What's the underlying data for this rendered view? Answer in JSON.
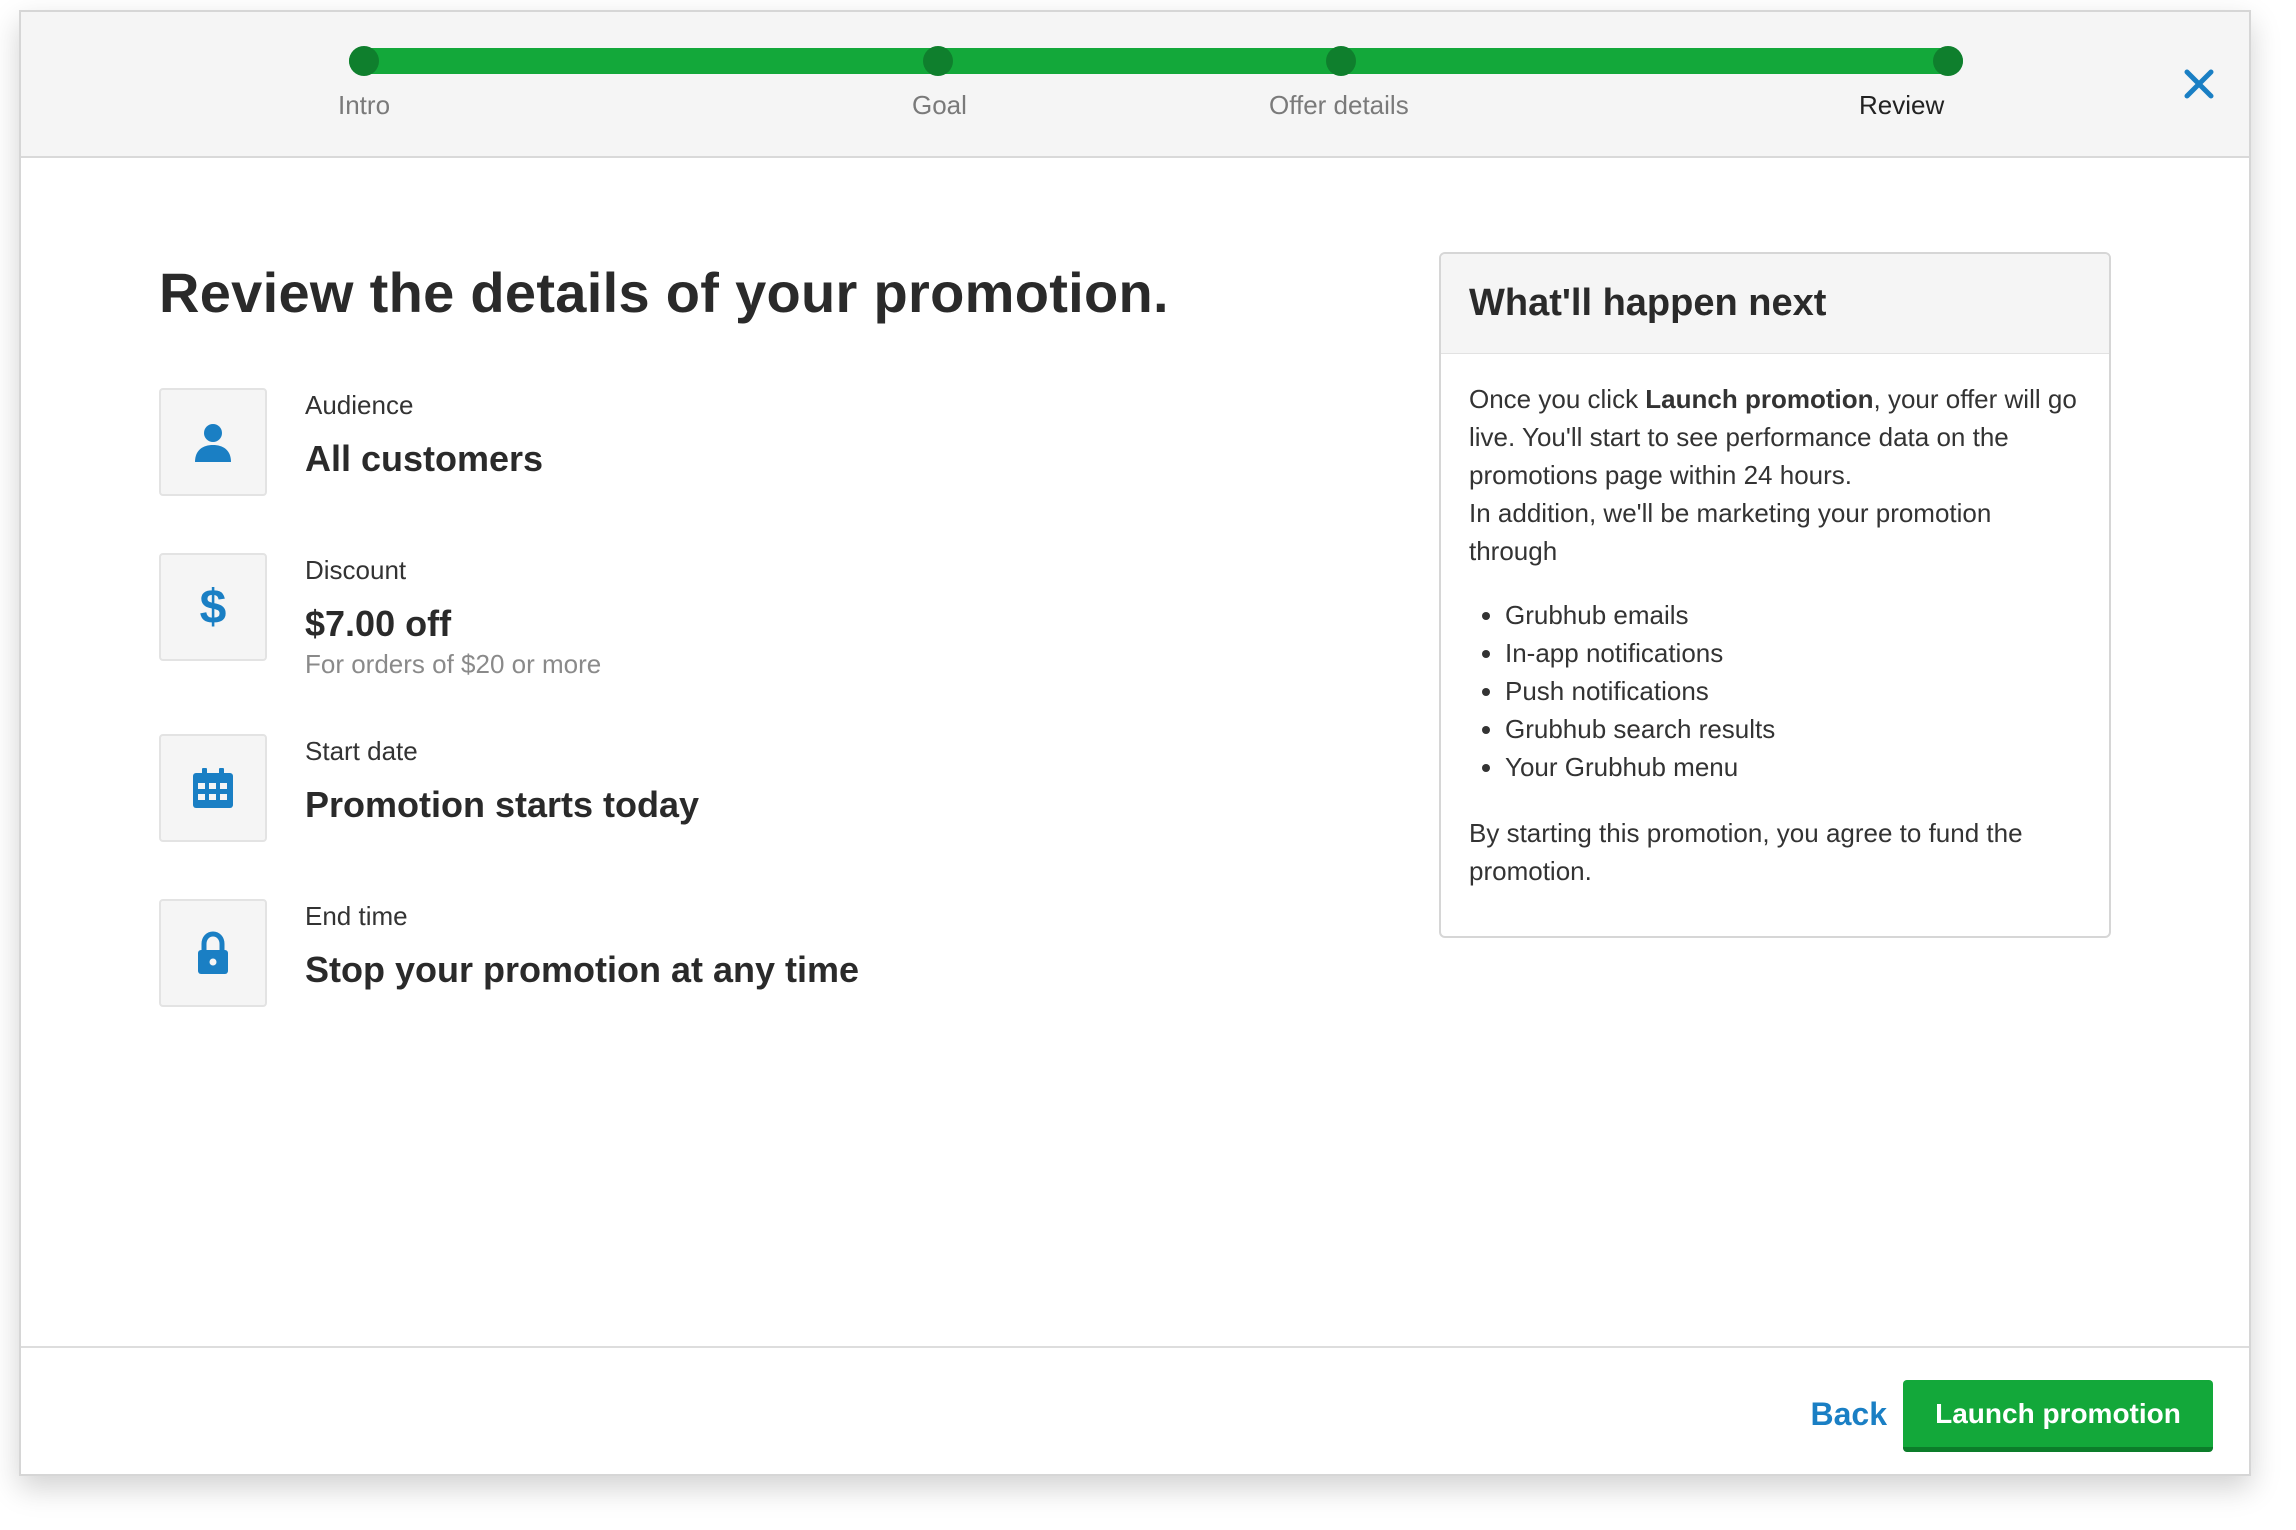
{
  "stepper": {
    "steps": [
      {
        "label": "Intro"
      },
      {
        "label": "Goal"
      },
      {
        "label": "Offer details"
      },
      {
        "label": "Review"
      }
    ],
    "active_step": "Review",
    "progress": 1.0,
    "color": "#13a83a"
  },
  "close_icon": "close-icon",
  "main": {
    "title": "Review the details of your promotion.",
    "details": [
      {
        "icon": "person-icon",
        "label": "Audience",
        "value": "All customers"
      },
      {
        "icon": "dollar-icon",
        "label": "Discount",
        "value": "$7.00 off",
        "sub": "For orders of $20 or more"
      },
      {
        "icon": "calendar-icon",
        "label": "Start date",
        "value": "Promotion starts today"
      },
      {
        "icon": "lock-icon",
        "label": "End time",
        "value": "Stop your promotion at any time"
      }
    ]
  },
  "panel": {
    "title": "What'll happen next",
    "intro_before": "Once you click ",
    "intro_bold": "Launch promotion",
    "intro_after": ", your offer will go live. You'll start to see performance data on the promotions page within 24 hours.",
    "addition": "In addition, we'll be marketing your promotion through",
    "channels": [
      "Grubhub emails",
      "In-app notifications",
      "Push notifications",
      "Grubhub search results",
      "Your Grubhub menu"
    ],
    "agreement": "By starting this promotion, you agree to fund the promotion."
  },
  "footer": {
    "back_label": "Back",
    "launch_label": "Launch promotion"
  },
  "colors": {
    "accent_green": "#13a83a",
    "link_blue": "#1a7fc4",
    "icon_blue": "#1a7fc4"
  }
}
